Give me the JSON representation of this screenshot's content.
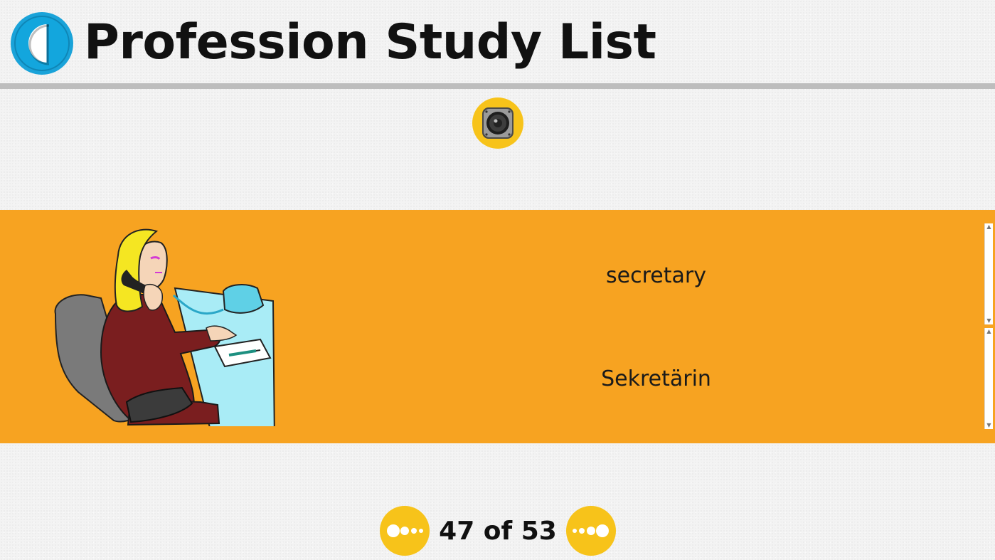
{
  "header": {
    "title": "Profession Study List",
    "back_icon": "back-half-circle-icon",
    "accent_color": "#1aa3d9"
  },
  "audio": {
    "icon": "speaker-icon",
    "button_color": "#f7c31a"
  },
  "card": {
    "background": "#f7a321",
    "illustration": "secretary-on-phone-illustration",
    "word_english": "secretary",
    "word_german": "Sekretärin"
  },
  "pager": {
    "prev_icon": "dots-left-icon",
    "next_icon": "dots-right-icon",
    "position_text": "47 of 53",
    "current": 47,
    "total": 53
  }
}
